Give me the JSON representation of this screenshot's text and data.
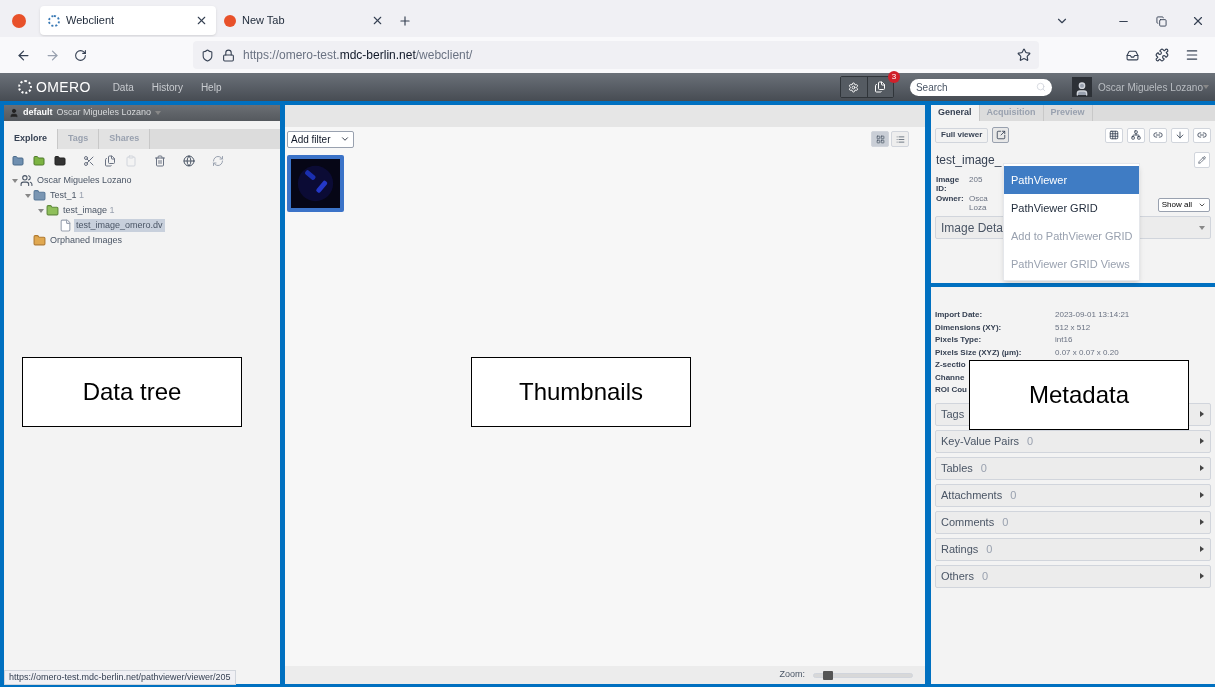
{
  "browser": {
    "tabs": [
      {
        "title": "Webclient",
        "selected": true
      },
      {
        "title": "New Tab",
        "selected": false
      }
    ],
    "url": "https://omero-test.**mdc-berlin.net**/webclient/",
    "status_url": "https://omero-test.mdc-berlin.net/pathviewer/viewer/205"
  },
  "header": {
    "logo": "OMERO",
    "nav": [
      "Data",
      "History",
      "Help"
    ],
    "badge": "3",
    "search": {
      "placeholder": "Search"
    },
    "user": "Oscar Migueles Lozano"
  },
  "left": {
    "group": "default",
    "user": "Oscar Migueles Lozano",
    "tabs": [
      {
        "label": "Explore",
        "selected": true
      },
      {
        "label": "Tags",
        "selected": false
      },
      {
        "label": "Shares",
        "selected": false
      }
    ],
    "tree": [
      {
        "kind": "user",
        "label": "Oscar Migueles Lozano",
        "expanded": true,
        "selected": false,
        "children": [
          {
            "kind": "project",
            "label": "Test_1",
            "count": "1",
            "expanded": true,
            "selected": false,
            "children": [
              {
                "kind": "dataset",
                "label": "test_image",
                "count": "1",
                "expanded": true,
                "selected": false,
                "children": [
                  {
                    "label": "test_image_omero.dv",
                    "selected": true
                  }
                ]
              }
            ]
          },
          {
            "kind": "orphaned",
            "label": "Orphaned Images",
            "selected": false
          }
        ]
      }
    ]
  },
  "middle": {
    "filter": "Add filter",
    "views": [
      {
        "kind": "grid",
        "selected": true
      },
      {
        "kind": "list",
        "selected": false
      }
    ],
    "thumbnails": [
      {
        "kind": "picture",
        "selected": true
      }
    ],
    "zoom": {
      "label": "Zoom:",
      "level": 0.1
    }
  },
  "right": {
    "tabs": [
      {
        "label": "General",
        "selected": true
      },
      {
        "label": "Acquisition",
        "selected": false
      },
      {
        "label": "Preview",
        "selected": false
      }
    ],
    "full_viewer": "Full viewer",
    "title": "test_image_",
    "fields": [
      {
        "label": "Image ID:",
        "value": "205"
      },
      {
        "label": "Owner:",
        "value": "Osca Loza"
      }
    ],
    "show_all": "Show all",
    "section": "Image Deta",
    "menu": [
      {
        "label": "PathViewer",
        "selected": true,
        "disabled": false
      },
      {
        "label": "PathViewer GRID",
        "selected": false,
        "disabled": false
      },
      {
        "label": "Add to PathViewer GRID",
        "selected": false,
        "disabled": true
      },
      {
        "label": "PathViewer GRID Views",
        "selected": false,
        "disabled": true
      }
    ],
    "metadata": [
      {
        "label": "Import Date:",
        "value": "2023-09-01 13:14:21"
      },
      {
        "label": "Dimensions (XY):",
        "value": "512 x 512"
      },
      {
        "label": "Pixels Type:",
        "value": "int16"
      },
      {
        "label": "Pixels Size (XYZ) (µm):",
        "value": "0.07 x 0.07 x 0.20"
      },
      {
        "label": "Z-sectio"
      },
      {
        "label": "Channe"
      },
      {
        "label": "ROI Cou"
      }
    ],
    "accordions": [
      {
        "label": "Tags"
      },
      {
        "label": "Key-Value Pairs",
        "count": "0"
      },
      {
        "label": "Tables",
        "count": "0"
      },
      {
        "label": "Attachments",
        "count": "0"
      },
      {
        "label": "Comments",
        "count": "0"
      },
      {
        "label": "Ratings",
        "count": "0"
      },
      {
        "label": "Others",
        "count": "0"
      }
    ]
  },
  "callouts": [
    "Data tree",
    "Thumbnails",
    "Metadata"
  ]
}
